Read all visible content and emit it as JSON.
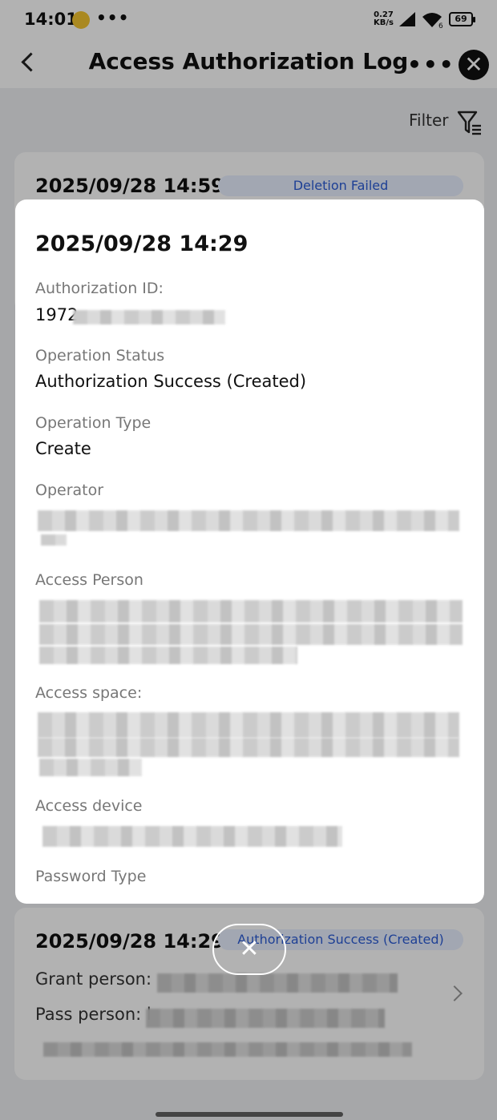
{
  "status_bar": {
    "time": "14:01",
    "dots": "•••",
    "speed_value": "0.27",
    "speed_unit": "KB/s",
    "wifi_badge": "6",
    "battery": "69"
  },
  "header": {
    "title": "Access Authorization Log",
    "more": "•••",
    "close": "✕"
  },
  "filter": {
    "label": "Filter"
  },
  "background_records": [
    {
      "date": "2025/09/28 14:59",
      "status": "Deletion Failed"
    },
    {
      "date": "2025/09/28 14:29",
      "status": "Authorization Success (Created)",
      "grant_label": "Grant person:",
      "pass_label": "Pass person: l"
    }
  ],
  "modal": {
    "date": "2025/09/28 14:29",
    "fields": [
      {
        "label": "Authorization ID:",
        "value": "1972"
      },
      {
        "label": "Operation Status",
        "value": "Authorization Success (Created)"
      },
      {
        "label": "Operation Type",
        "value": "Create"
      },
      {
        "label": "Operator",
        "value": ""
      },
      {
        "label": "Access Person",
        "value": ""
      },
      {
        "label": "Access space:",
        "value": ""
      },
      {
        "label": "Access device",
        "value": ""
      },
      {
        "label": "Password Type",
        "value": ""
      }
    ]
  },
  "close_button": {
    "label": "✕"
  },
  "colors": {
    "accent": "#2b5cd6",
    "pill_bg": "#e8efff",
    "overlay": "rgba(0,0,0,0.30)"
  },
  "icons": [
    "back-arrow-icon",
    "more-icon",
    "close-icon",
    "filter-icon",
    "chevron-right-icon",
    "signal-icon",
    "wifi-icon",
    "battery-icon"
  ]
}
